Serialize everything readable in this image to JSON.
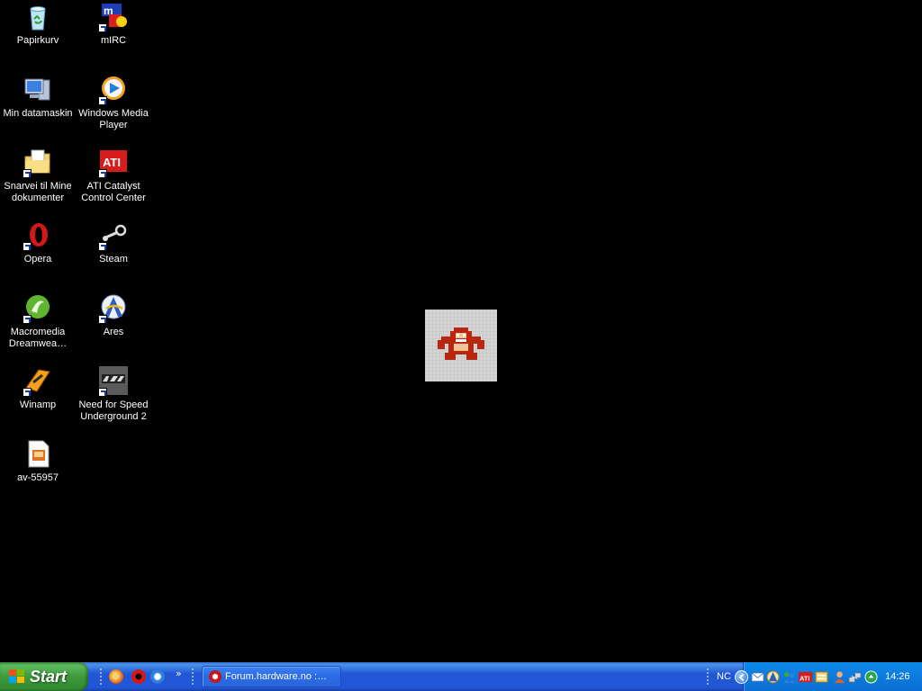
{
  "desktop": {
    "icons": [
      {
        "label": "Papirkurv",
        "icon": "recycle-bin-icon"
      },
      {
        "label": "mIRC",
        "icon": "mirc-icon"
      },
      {
        "label": "Min datamaskin",
        "icon": "my-computer-icon"
      },
      {
        "label": "Windows Media Player",
        "icon": "media-player-icon"
      },
      {
        "label": "Snarvei til Mine dokumenter",
        "icon": "folder-icon"
      },
      {
        "label": "ATI Catalyst Control Center",
        "icon": "ati-icon"
      },
      {
        "label": "Opera",
        "icon": "opera-icon"
      },
      {
        "label": "Steam",
        "icon": "steam-icon"
      },
      {
        "label": "Macromedia Dreamwea…",
        "icon": "dreamweaver-icon"
      },
      {
        "label": "Ares",
        "icon": "ares-icon"
      },
      {
        "label": "Winamp",
        "icon": "winamp-icon"
      },
      {
        "label": "Need for Speed Underground 2",
        "icon": "nfs-icon"
      },
      {
        "label": "av-55957",
        "icon": "image-file-icon"
      }
    ],
    "wallpaper": {
      "icon": "donkey-kong-sprite-icon"
    }
  },
  "taskbar": {
    "start_label": "Start",
    "quick_launch": [
      {
        "icon": "firefox-icon"
      },
      {
        "icon": "opera-icon"
      },
      {
        "icon": "ie-icon"
      }
    ],
    "tasks": [
      {
        "label": "Forum.hardware.no :…",
        "icon": "opera-icon"
      }
    ],
    "tray": {
      "lang": "NC",
      "icons": [
        "show-hidden-icon",
        "mail-icon",
        "network-icon",
        "messenger-icon",
        "ati-tray-icon",
        "folder-tray-icon",
        "user-icon",
        "network-shield-icon",
        "update-icon"
      ],
      "clock": "14:26"
    }
  },
  "colors": {
    "taskbar_blue": "#2157d7",
    "start_green": "#3f993f",
    "tray_blue": "#0c7ae0",
    "desktop_bg": "#000000"
  }
}
